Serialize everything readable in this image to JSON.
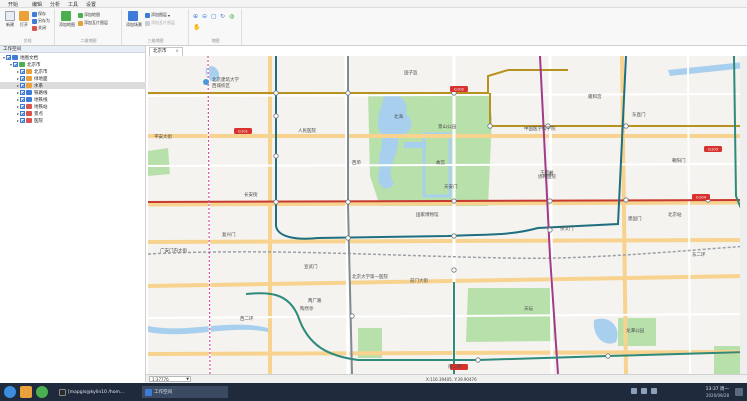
{
  "menubar": {
    "items": [
      "开始",
      "编辑",
      "分析",
      "工具",
      "设置"
    ]
  },
  "ribbon": {
    "groups": [
      {
        "name": "文档",
        "big": [
          "新建",
          "打开"
        ],
        "small": [
          "保存",
          "另存为",
          "关闭"
        ]
      },
      {
        "name": "二维地图",
        "big": [
          "添加地图"
        ],
        "small": [
          "添加地图",
          "添加瓦片图层"
        ]
      },
      {
        "name": "三维地图",
        "big": [
          "添加场景"
        ],
        "small": [
          "添加图层",
          "添加瓦片图层"
        ]
      },
      {
        "name": "地图",
        "tools": [
          "放大",
          "缩小",
          "全图",
          "刷新",
          "漫游"
        ]
      }
    ],
    "icon_colors": {
      "blue": "#3d7dd8",
      "green": "#4bae4f",
      "orange": "#e9a23b",
      "gray": "#9aa3ad"
    }
  },
  "panel": {
    "title": "工作空间",
    "tree": [
      {
        "label": "地图文档",
        "level": 0,
        "expanded": true,
        "icon": "map-doc-icon"
      },
      {
        "label": "北京市",
        "level": 1,
        "expanded": true,
        "icon": "map-icon"
      },
      {
        "label": "北京市",
        "level": 2,
        "expanded": false,
        "icon": "polygon-layer-icon"
      },
      {
        "label": "绿地面",
        "level": 2,
        "expanded": false,
        "icon": "polygon-layer-icon"
      },
      {
        "label": "水系",
        "level": 2,
        "expanded": false,
        "icon": "polygon-layer-icon",
        "selected": true
      },
      {
        "label": "铁路线",
        "level": 2,
        "expanded": false,
        "icon": "line-layer-icon"
      },
      {
        "label": "地铁线",
        "level": 2,
        "expanded": false,
        "icon": "line-layer-icon"
      },
      {
        "label": "地铁站",
        "level": 2,
        "expanded": false,
        "icon": "point-layer-icon"
      },
      {
        "label": "景点",
        "level": 2,
        "expanded": false,
        "icon": "point-layer-icon"
      },
      {
        "label": "医院",
        "level": 2,
        "expanded": false,
        "icon": "point-layer-icon"
      }
    ]
  },
  "map_tab": {
    "label": "北京市",
    "close": "×"
  },
  "map": {
    "colors": {
      "land": "#f5f3ef",
      "green": "#b8e0ab",
      "water": "#a8d0ee",
      "road_main": "#f7d38f",
      "road_minor": "#ffffff",
      "rail": "#9aa0a6",
      "metro_gray": "#7e8b92",
      "metro_green": "#2e8a7a",
      "metro_red": "#c8392f",
      "metro_brown": "#b79220",
      "metro_purple": "#a23a8a",
      "metro_teal": "#1f6f80",
      "metro_pink": "#d34c9a"
    },
    "labels": {
      "university": "北京建筑大学",
      "campus": "西城校区",
      "guozijian": "国子监",
      "lama": "雍和宫",
      "beihai": "北海",
      "jingshan": "景山公园",
      "palace": "故宫",
      "tiananmen": "天安门",
      "museum": "国家博物馆",
      "chongwenmen": "崇文门",
      "dongdan": "东单",
      "wangfujing": "王府井",
      "xidan": "西单",
      "fuxingmen": "复兴门",
      "xuanwumen": "宣武门",
      "taoranting": "陶然亭",
      "tiantan": "天坛",
      "beijingzhan": "北京站",
      "jianguomen": "建国门",
      "dongzhimen": "东直门",
      "chaoyangmen": "朝阳门",
      "hospital1": "协和医院",
      "hospital2": "人民医院",
      "hospital3": "北京大学第一医院",
      "hospital4": "中国医学科学院",
      "park": "龙潭公园",
      "road1": "平安大街",
      "road2": "长安街",
      "road3": "前门大街",
      "road4": "广安门内大街",
      "road5": "两广路",
      "road6": "东二环",
      "road7": "西二环",
      "road8": "南二环",
      "badge1": "G101",
      "badge2": "G102",
      "badge3": "G103",
      "badge4": "G104"
    }
  },
  "statusbar": {
    "scale": "1:37776",
    "coords": "X:116.39405, Y:39.90476"
  },
  "taskbar": {
    "tasks": [
      {
        "label": "[mapgis@kylin10 /hom...",
        "active": false
      },
      {
        "label": "工作空间",
        "active": true
      }
    ],
    "time": "13:37 周一",
    "date": "2020/09/28"
  }
}
